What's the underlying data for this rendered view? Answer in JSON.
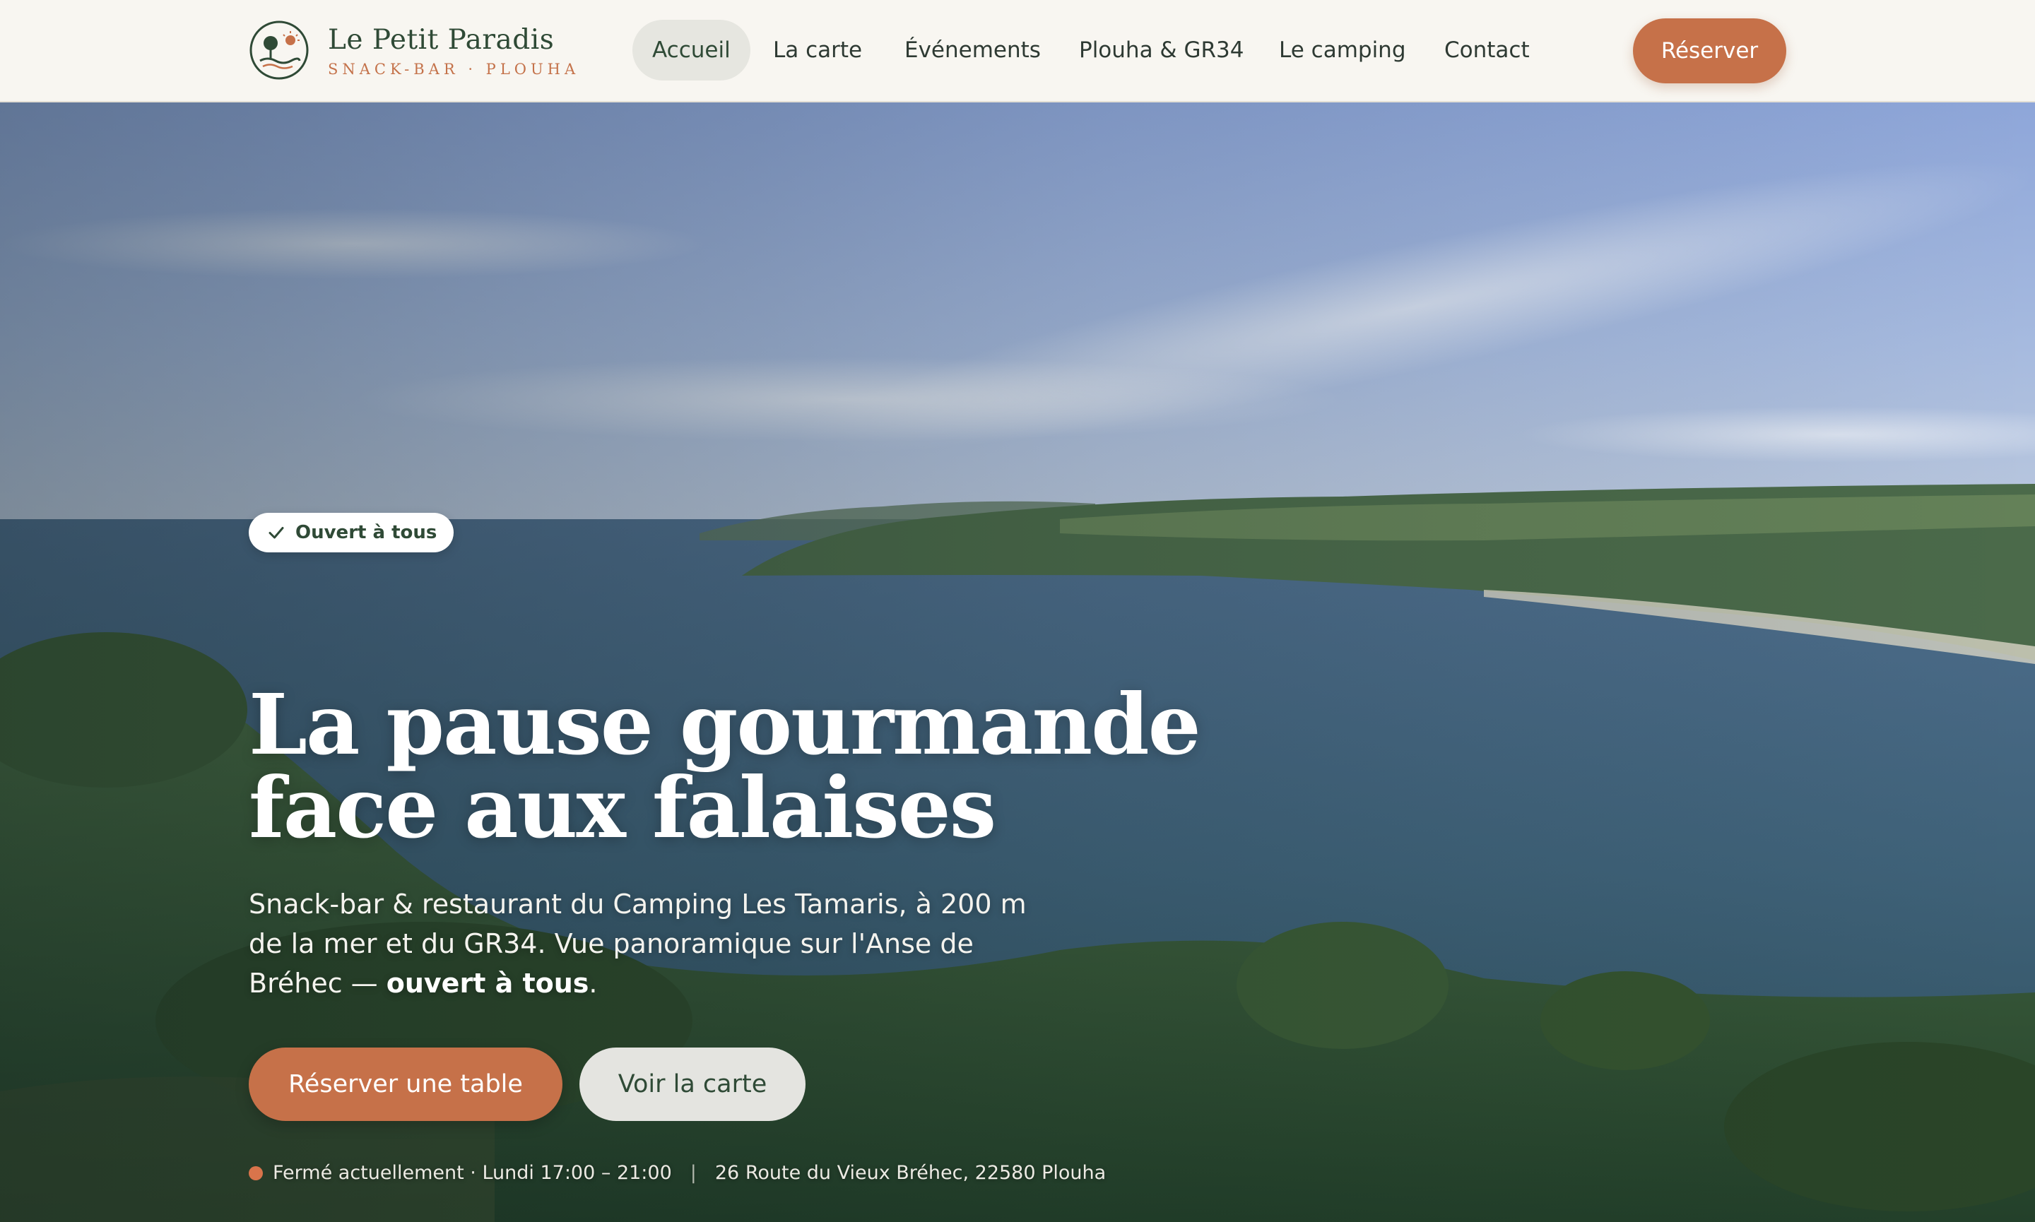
{
  "brand": {
    "name": "Le Petit Paradis",
    "tagline": "SNACK-BAR · PLOUHA",
    "logo_icon": "tree-sun-logo-icon"
  },
  "nav": {
    "items": [
      {
        "label": "Accueil",
        "active": true
      },
      {
        "label": "La carte",
        "active": false
      },
      {
        "label": "Événements",
        "active": false
      },
      {
        "label": "Plouha & GR34",
        "active": false
      },
      {
        "label": "Le camping",
        "active": false
      },
      {
        "label": "Contact",
        "active": false
      }
    ],
    "cta_label": "Réserver"
  },
  "hero": {
    "badge": "Ouvert à tous",
    "badge_icon": "check-icon",
    "title_line1": "La pause gourmande",
    "title_line2": "face aux falaises",
    "desc_part1": "Snack-bar & restaurant du Camping Les Tamaris, à 200 m de la mer et du GR34. Vue panoramique sur l'Anse de Bréhec — ",
    "desc_bold": "ouvert à tous",
    "desc_part2": ".",
    "primary_cta": "Réserver une table",
    "secondary_cta": "Voir la carte",
    "status_text": "Fermé actuellement · Lundi 17:00 – 21:00",
    "status_separator": "|",
    "address": "26 Route du Vieux Bréhec, 22580 Plouha"
  },
  "colors": {
    "accent": "#c67149",
    "brand_green": "#2f4a36",
    "header_bg": "#f8f6f1",
    "status_closed": "#d9744b"
  }
}
